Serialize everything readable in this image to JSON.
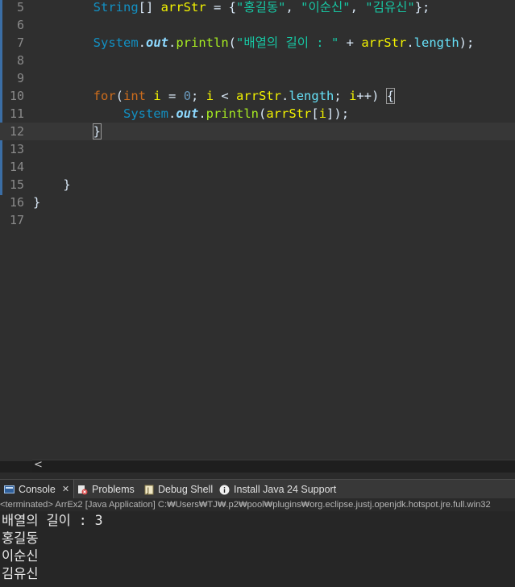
{
  "editor": {
    "lines": [
      {
        "num": "5"
      },
      {
        "num": "6"
      },
      {
        "num": "7"
      },
      {
        "num": "8"
      },
      {
        "num": "9"
      },
      {
        "num": "10"
      },
      {
        "num": "11"
      },
      {
        "num": "12"
      },
      {
        "num": "13"
      },
      {
        "num": "14"
      },
      {
        "num": "15"
      },
      {
        "num": "16"
      },
      {
        "num": "17"
      }
    ],
    "tokens": {
      "l5_type": "String",
      "l5_a": "[] ",
      "l5_var": "arrStr",
      "l5_b": " = {",
      "l5_s1": "\"홍길동\"",
      "l5_c1": ", ",
      "l5_s2": "\"이순신\"",
      "l5_c2": ", ",
      "l5_s3": "\"김유신\"",
      "l5_end": "};",
      "l7_type": "System",
      "l7_dot1": ".",
      "l7_field": "out",
      "l7_dot2": ".",
      "l7_method": "println",
      "l7_open": "(",
      "l7_str": "\"배열의 길이 : \"",
      "l7_plus": " + ",
      "l7_var": "arrStr",
      "l7_dot3": ".",
      "l7_attr": "length",
      "l7_end": ");",
      "l10_kw": "for",
      "l10_open": "(",
      "l10_kw2": "int",
      "l10_sp": " ",
      "l10_i1": "i",
      "l10_eq": " = ",
      "l10_zero": "0",
      "l10_semi1": "; ",
      "l10_i2": "i",
      "l10_lt": " < ",
      "l10_var": "arrStr",
      "l10_dot": ".",
      "l10_attr": "length",
      "l10_semi2": "; ",
      "l10_i3": "i",
      "l10_inc": "++) ",
      "l10_brace": "{",
      "l11_type": "System",
      "l11_dot1": ".",
      "l11_field": "out",
      "l11_dot2": ".",
      "l11_method": "println",
      "l11_open": "(",
      "l11_var": "arrStr",
      "l11_idx_open": "[",
      "l11_i": "i",
      "l11_end": "]);",
      "l12_brace": "}",
      "l15_brace": "}",
      "l16_brace": "}"
    }
  },
  "scrollbar": {
    "left_arrow": "<"
  },
  "tabs": [
    {
      "label": "Console",
      "close": "✕"
    },
    {
      "label": "Problems"
    },
    {
      "label": "Debug Shell"
    },
    {
      "label": "Install Java 24 Support"
    }
  ],
  "status_line": "<terminated> ArrEx2 [Java Application] C:₩Users₩TJ₩.p2₩pool₩plugins₩org.eclipse.justj.openjdk.hotspot.jre.full.win32",
  "console_output": [
    "배열의 길이 : 3",
    "홍길동",
    "이순신",
    "김유신"
  ],
  "colors": {
    "keyword": "#cc6c1d",
    "type": "#1290c3",
    "string": "#17c6a3",
    "method": "#a7ec21",
    "variable": "#f2f200"
  }
}
